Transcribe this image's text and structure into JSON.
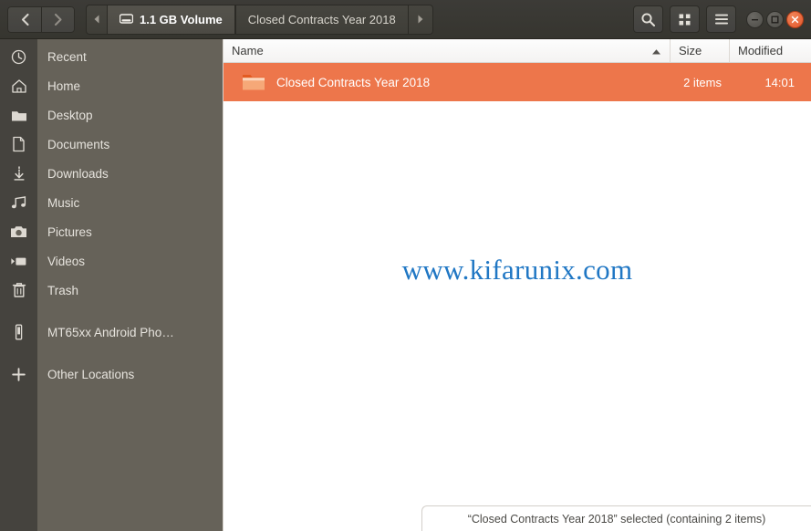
{
  "window": {
    "title": "1.1 GB Volume",
    "controls": {
      "minimize_label": "Minimize",
      "maximize_label": "Maximize",
      "close_label": "Close"
    }
  },
  "header": {
    "back_label": "Back",
    "forward_label": "Forward",
    "path_prev_label": "Previous path",
    "path_next_label": "Next path",
    "breadcrumbs": [
      {
        "label": "1.1 GB Volume",
        "icon": "drive-icon",
        "active": true
      },
      {
        "label": "Closed Contracts Year 2018",
        "icon": "",
        "active": false
      }
    ],
    "search_label": "Search",
    "view_grid_label": "View options",
    "menu_label": "Menu"
  },
  "sidebar": {
    "items": [
      {
        "label": "Recent",
        "icon": "clock-icon"
      },
      {
        "label": "Home",
        "icon": "home-icon"
      },
      {
        "label": "Desktop",
        "icon": "folder-icon"
      },
      {
        "label": "Documents",
        "icon": "document-icon"
      },
      {
        "label": "Downloads",
        "icon": "download-icon"
      },
      {
        "label": "Music",
        "icon": "music-icon"
      },
      {
        "label": "Pictures",
        "icon": "camera-icon"
      },
      {
        "label": "Videos",
        "icon": "video-icon"
      },
      {
        "label": "Trash",
        "icon": "trash-icon"
      },
      {
        "label": "MT65xx Android Pho…",
        "icon": "phone-icon"
      },
      {
        "label": "Other Locations",
        "icon": "plus-icon"
      }
    ]
  },
  "filelist": {
    "columns": [
      {
        "key": "name",
        "label": "Name",
        "sorted": true,
        "sort_direction": "ascending"
      },
      {
        "key": "size",
        "label": "Size",
        "sorted": false,
        "sort_direction": ""
      },
      {
        "key": "modified",
        "label": "Modified",
        "sorted": false,
        "sort_direction": ""
      }
    ],
    "rows": [
      {
        "name": "Closed Contracts Year 2018",
        "size": "2 items",
        "modified": "14:01",
        "icon": "folder-icon",
        "selected": true
      }
    ]
  },
  "watermark": {
    "text": "www.kifarunix.com"
  },
  "statusbar": {
    "text": "“Closed Contracts Year 2018” selected  (containing 2 items)"
  },
  "colors": {
    "header_bg": "#3a3934",
    "sidebar_bg": "#666259",
    "sidebar_strip_bg": "#45433e",
    "selection": "#ed764b",
    "watermark": "#2077c4",
    "close_button": "#e2552a"
  }
}
